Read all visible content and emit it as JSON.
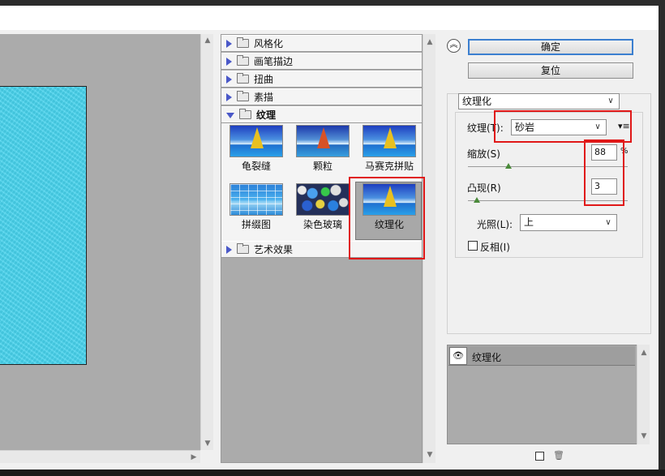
{
  "dialog": {
    "ok_label": "确定",
    "reset_label": "复位"
  },
  "gallery": {
    "categories": [
      {
        "label": "风格化",
        "expanded": false
      },
      {
        "label": "画笔描边",
        "expanded": false
      },
      {
        "label": "扭曲",
        "expanded": false
      },
      {
        "label": "素描",
        "expanded": false
      },
      {
        "label": "纹理",
        "expanded": true
      },
      {
        "label": "艺术效果",
        "expanded": false
      }
    ],
    "texture_filters": [
      {
        "label": "龟裂缝",
        "selected": false
      },
      {
        "label": "颗粒",
        "selected": false
      },
      {
        "label": "马赛克拼贴",
        "selected": false
      },
      {
        "label": "拼缀图",
        "selected": false
      },
      {
        "label": "染色玻璃",
        "selected": false
      },
      {
        "label": "纹理化",
        "selected": true
      }
    ]
  },
  "settings": {
    "filter_select": "纹理化",
    "texture_label": "纹理(T):",
    "texture_value": "砂岩",
    "scaling_label": "缩放(S)",
    "scaling_value": "88",
    "scaling_unit": "%",
    "scaling_level": 0.88,
    "relief_label": "凸现(R)",
    "relief_value": "3",
    "relief_level": 0.06,
    "light_label": "光照(L):",
    "light_value": "上",
    "invert_label": "反相(I)",
    "invert_checked": false
  },
  "layers": {
    "items": [
      {
        "label": "纹理化",
        "visible": true
      }
    ]
  },
  "colors": {
    "annotation_red": "#e01818",
    "preview_cyan": "#49d7f1",
    "accent_blue": "#3b7fd0"
  }
}
